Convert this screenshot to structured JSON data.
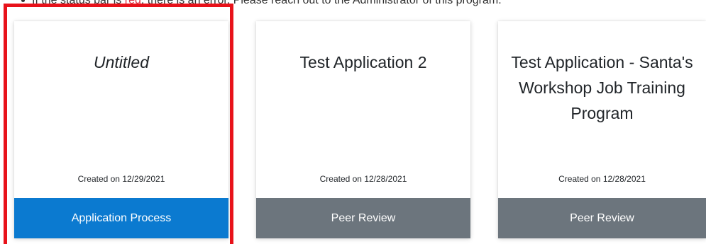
{
  "notice": {
    "prefix": "If the status bar is ",
    "red_word": "red",
    "suffix": ", there is an error. Please reach out to the Administrator of this program."
  },
  "cards": [
    {
      "title": "Untitled",
      "created": "Created on 12/29/2021",
      "action_label": "Application Process"
    },
    {
      "title": "Test Application 2",
      "created": "Created on 12/28/2021",
      "action_label": "Peer Review"
    },
    {
      "title": "Test Application - Santa's Workshop Job Training Program",
      "created": "Created on 12/28/2021",
      "action_label": "Peer Review"
    }
  ],
  "colors": {
    "primary_action": "#0b7ad0",
    "secondary_action": "#6c757d",
    "highlight_border": "#e8121a",
    "error_text": "#dc3545"
  }
}
